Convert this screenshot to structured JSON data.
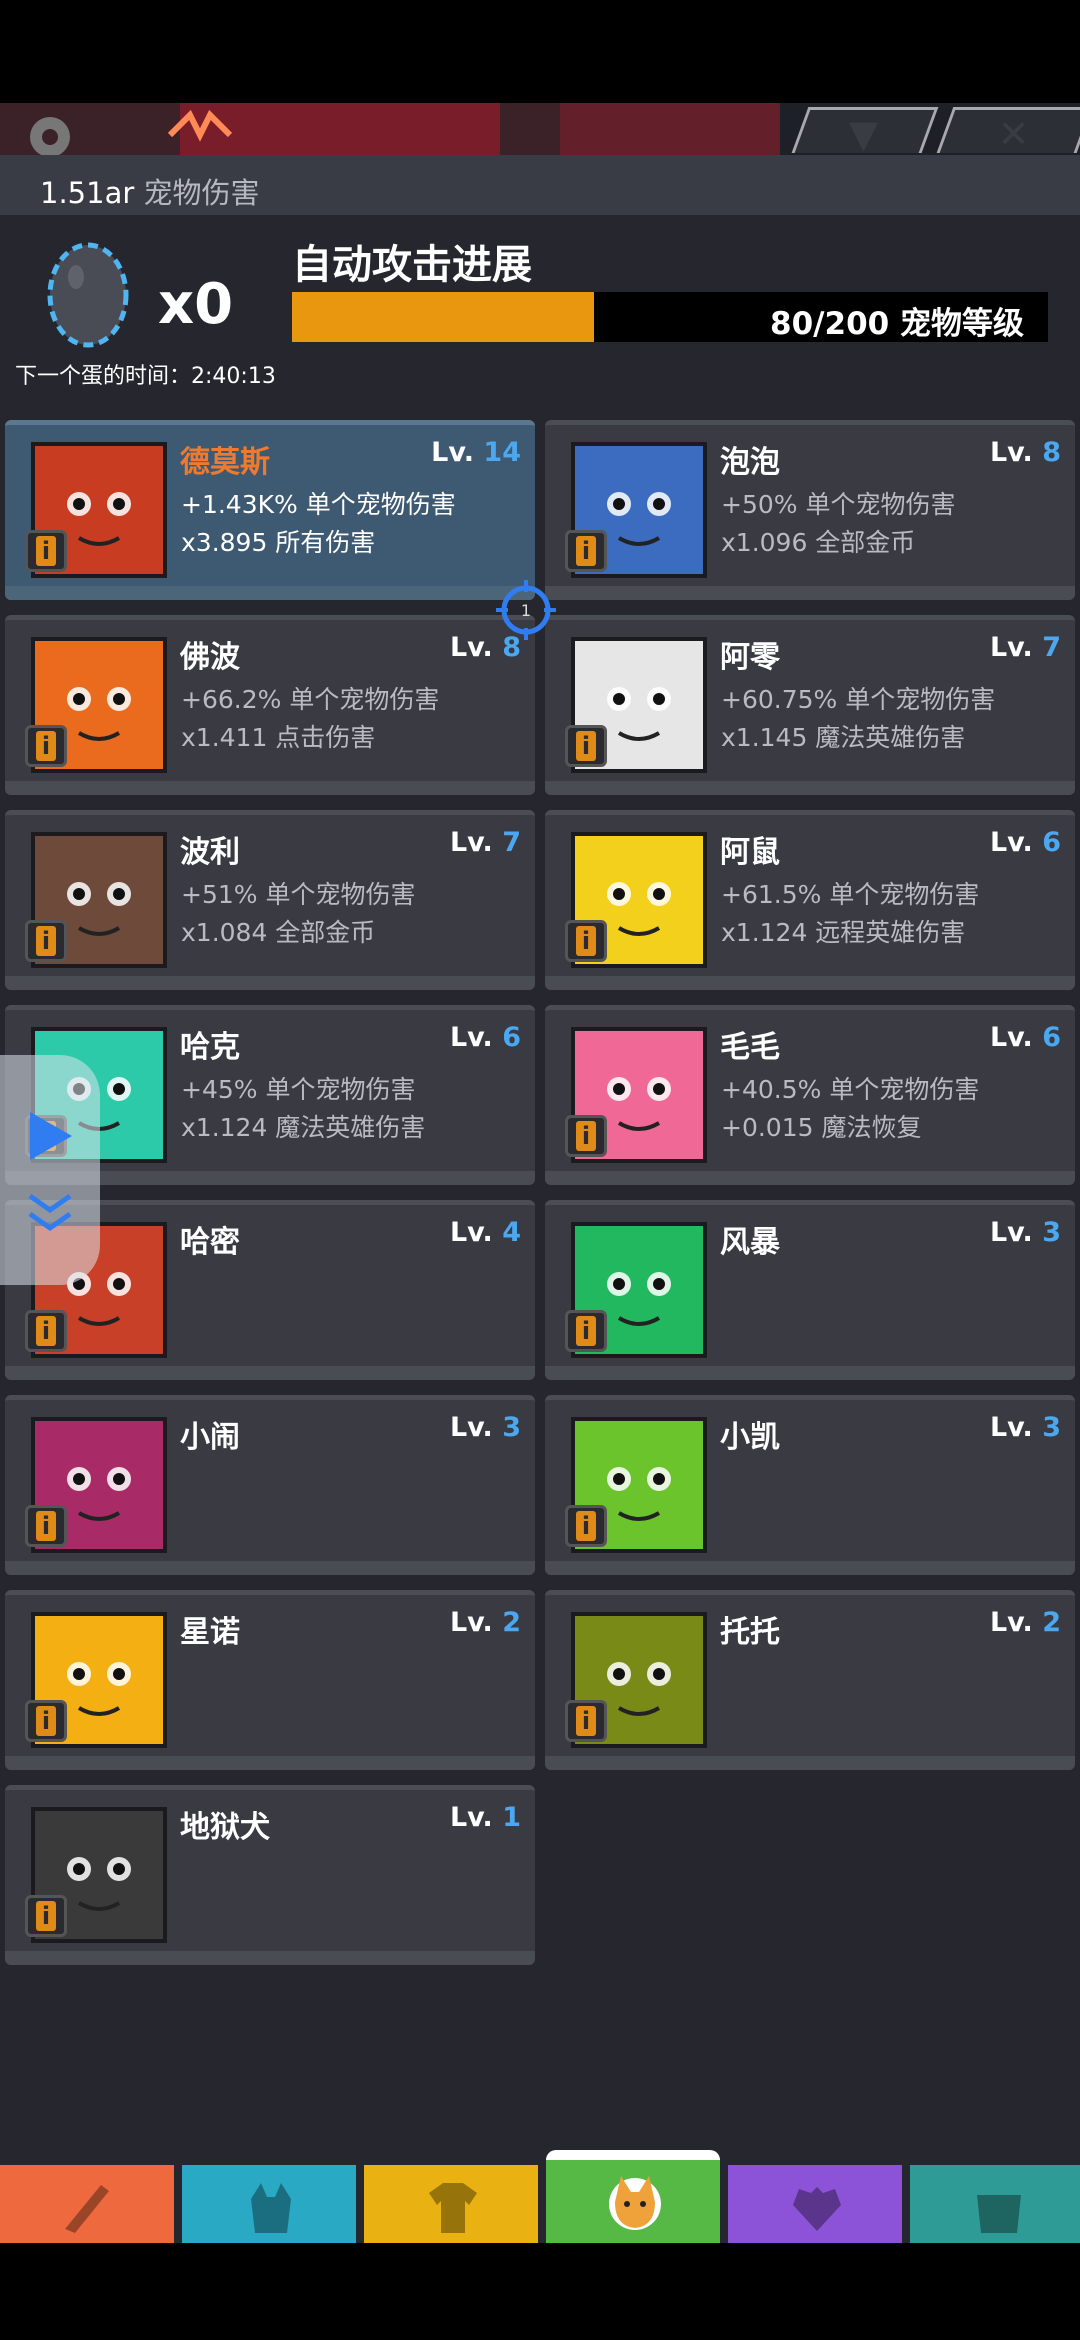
{
  "header": {
    "damage_value": "1.51ar",
    "damage_label": "宠物伤害",
    "collapse_icon": "chevron-down-icon",
    "close_icon": "close-icon"
  },
  "egg": {
    "count": "x0",
    "next_egg_label": "下一个蛋的时间：2:40:13"
  },
  "progress": {
    "title": "自动攻击进展",
    "value_text": "80/200 宠物等级",
    "current": 80,
    "max": 200,
    "fill_color": "#e8970f"
  },
  "pets": [
    {
      "name": "德莫斯",
      "lv_prefix": "Lv. ",
      "level": "14",
      "bonus1": "+1.43K% 单个宠物伤害",
      "bonus2": "x3.895 所有伤害",
      "selected": true,
      "color": "#c83c22"
    },
    {
      "name": "泡泡",
      "lv_prefix": "Lv. ",
      "level": "8",
      "bonus1": "+50% 单个宠物伤害",
      "bonus2": "x1.096 全部金币",
      "color": "#3c6cc0"
    },
    {
      "name": "佛波",
      "lv_prefix": "Lv. ",
      "level": "8",
      "bonus1": "+66.2% 单个宠物伤害",
      "bonus2": "x1.411 点击伤害",
      "color": "#ea6a1e"
    },
    {
      "name": "阿零",
      "lv_prefix": "Lv. ",
      "level": "7",
      "bonus1": "+60.75% 单个宠物伤害",
      "bonus2": "x1.145 魔法英雄伤害",
      "color": "#e6e6e6"
    },
    {
      "name": "波利",
      "lv_prefix": "Lv. ",
      "level": "7",
      "bonus1": "+51% 单个宠物伤害",
      "bonus2": "x1.084 全部金币",
      "color": "#6e4a3a"
    },
    {
      "name": "阿鼠",
      "lv_prefix": "Lv. ",
      "level": "6",
      "bonus1": "+61.5% 单个宠物伤害",
      "bonus2": "x1.124 远程英雄伤害",
      "color": "#f2d01c"
    },
    {
      "name": "哈克",
      "lv_prefix": "Lv. ",
      "level": "6",
      "bonus1": "+45% 单个宠物伤害",
      "bonus2": "x1.124 魔法英雄伤害",
      "color": "#2ccaa8"
    },
    {
      "name": "毛毛",
      "lv_prefix": "Lv. ",
      "level": "6",
      "bonus1": "+40.5% 单个宠物伤害",
      "bonus2": "+0.015 魔法恢复",
      "color": "#f06896"
    },
    {
      "name": "哈密",
      "lv_prefix": "Lv. ",
      "level": "4",
      "bonus1": "",
      "bonus2": "",
      "color": "#c84028"
    },
    {
      "name": "风暴",
      "lv_prefix": "Lv. ",
      "level": "3",
      "bonus1": "",
      "bonus2": "",
      "color": "#22b860"
    },
    {
      "name": "小闹",
      "lv_prefix": "Lv. ",
      "level": "3",
      "bonus1": "",
      "bonus2": "",
      "color": "#a82a66"
    },
    {
      "name": "小凯",
      "lv_prefix": "Lv. ",
      "level": "3",
      "bonus1": "",
      "bonus2": "",
      "color": "#6cc42c"
    },
    {
      "name": "星诺",
      "lv_prefix": "Lv. ",
      "level": "2",
      "bonus1": "",
      "bonus2": "",
      "color": "#f4b012"
    },
    {
      "name": "托托",
      "lv_prefix": "Lv. ",
      "level": "2",
      "bonus1": "",
      "bonus2": "",
      "color": "#7a8a16"
    },
    {
      "name": "地狱犬",
      "lv_prefix": "Lv. ",
      "level": "1",
      "bonus1": "",
      "bonus2": "",
      "color": "#3a3a3a"
    }
  ],
  "info_icon_glyph": "i",
  "crosshair_label": "1",
  "nav": [
    {
      "icon": "sword-icon",
      "color": "#ee6a3e"
    },
    {
      "icon": "helmet-icon",
      "color": "#2aa9c4"
    },
    {
      "icon": "shirt-icon",
      "color": "#e9b212"
    },
    {
      "icon": "pet-icon",
      "color": "#56b845",
      "active": true
    },
    {
      "icon": "heart-icon",
      "color": "#8c52d8"
    },
    {
      "icon": "chest-icon",
      "color": "#2f9b96"
    }
  ]
}
